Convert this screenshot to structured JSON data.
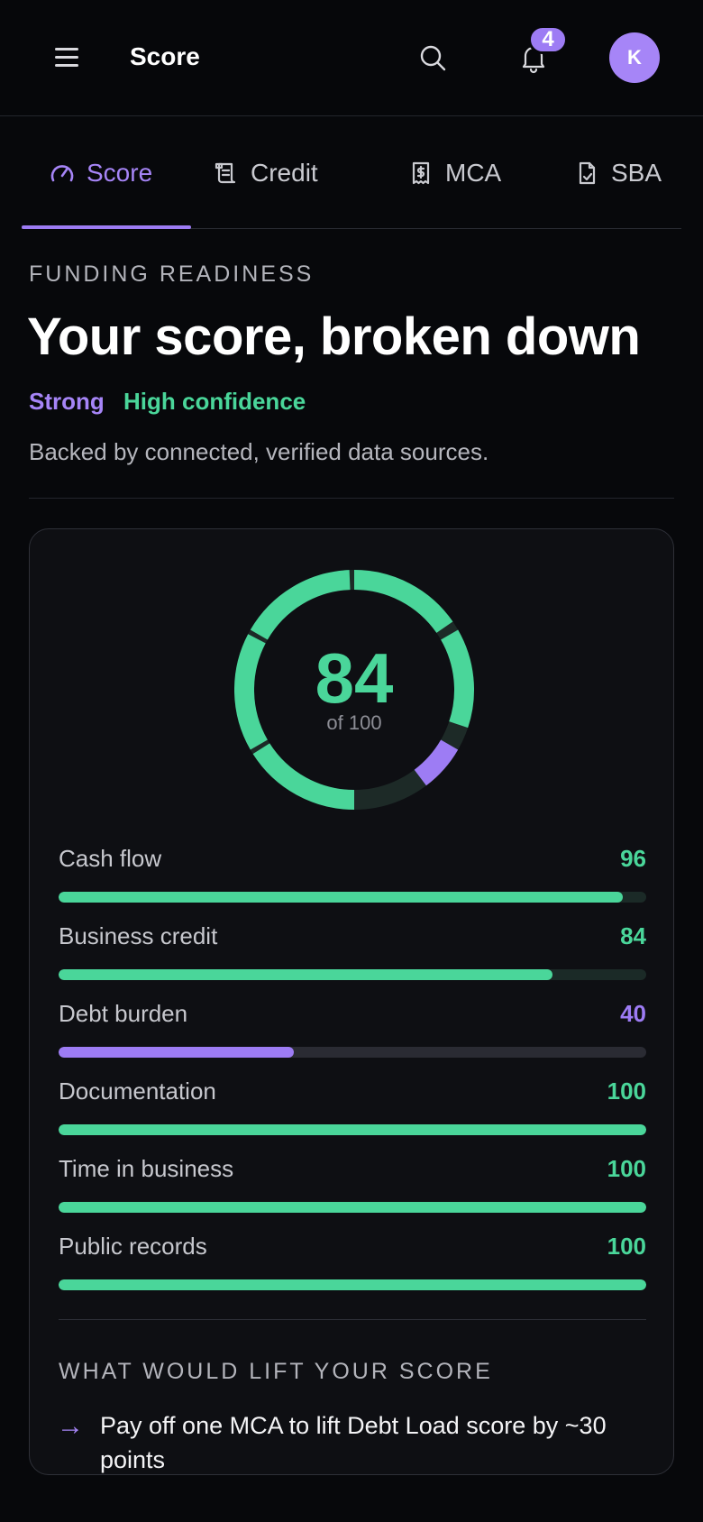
{
  "header": {
    "title": "Score",
    "notification_count": "4",
    "avatar_initial": "K"
  },
  "tabs": [
    {
      "label": "Score",
      "icon": "gauge-icon",
      "active": true
    },
    {
      "label": "Credit",
      "icon": "scroll-icon",
      "active": false
    },
    {
      "label": "MCA",
      "icon": "receipt-dollar-icon",
      "active": false
    },
    {
      "label": "SBA",
      "icon": "document-check-icon",
      "active": false
    }
  ],
  "intro": {
    "eyebrow": "FUNDING READINESS",
    "headline": "Your score, broken down",
    "rating": "Strong",
    "confidence": "High confidence",
    "subtext": "Backed by connected, verified data sources."
  },
  "score": {
    "value": "84",
    "max_label": "of 100"
  },
  "colors": {
    "accent": "#9d7cf4",
    "positive": "#4ad69a",
    "background": "#07080b",
    "card": "#0e0f13"
  },
  "factors": [
    {
      "label": "Cash flow",
      "value": 96,
      "status": "good"
    },
    {
      "label": "Business credit",
      "value": 84,
      "status": "good"
    },
    {
      "label": "Debt burden",
      "value": 40,
      "status": "weak"
    },
    {
      "label": "Documentation",
      "value": 100,
      "status": "good"
    },
    {
      "label": "Time in business",
      "value": 100,
      "status": "good"
    },
    {
      "label": "Public records",
      "value": 100,
      "status": "good"
    }
  ],
  "lift": {
    "title": "WHAT WOULD LIFT YOUR SCORE",
    "arrow": "→",
    "items": [
      "Pay off one MCA to lift Debt Load score by ~30 points"
    ]
  }
}
